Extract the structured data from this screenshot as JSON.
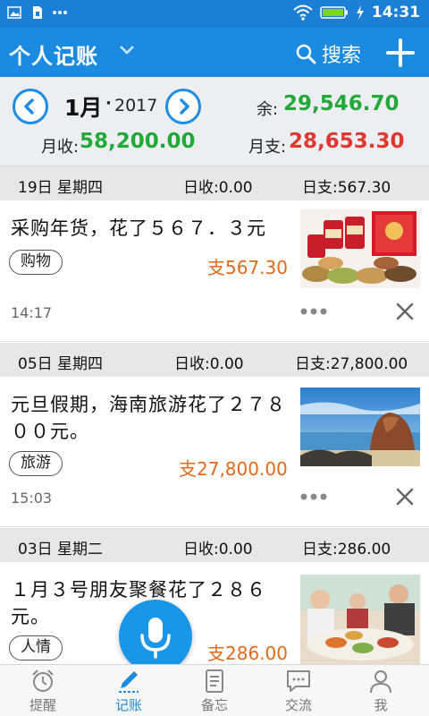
{
  "status_bar": {
    "time": "14:31"
  },
  "app_bar": {
    "title": "个人记账",
    "search_label": "搜索"
  },
  "summary": {
    "month": "1月",
    "dot": "·",
    "year": "2017",
    "balance_label": "余:",
    "balance_value": "29,546.70",
    "income_label": "月收:",
    "income_value": "58,200.00",
    "expense_label": "月支:",
    "expense_value": "28,653.30"
  },
  "days": [
    {
      "date": "19日  星期四",
      "income": "日收:0.00",
      "expense": "日支:567.30",
      "record": {
        "text": "采购年货，花了５６７．３元",
        "tag": "购物",
        "amount": "支567.30",
        "time": "14:17"
      }
    },
    {
      "date": "05日  星期四",
      "income": "日收:0.00",
      "expense": "日支:27,800.00",
      "record": {
        "text": "元旦假期，海南旅游花了２７８００元。",
        "tag": "旅游",
        "amount": "支27,800.00",
        "time": "15:03"
      }
    },
    {
      "date": "03日  星期二",
      "income": "日收:0.00",
      "expense": "日支:286.00",
      "record": {
        "text": "１月３号朋友聚餐花了２８６元。",
        "tag": "人情",
        "amount": "支286.00"
      }
    }
  ],
  "bottom_nav": [
    {
      "label": "提醒",
      "icon": "alarm-clock-icon"
    },
    {
      "label": "记账",
      "icon": "pencil-icon"
    },
    {
      "label": "备忘",
      "icon": "memo-icon"
    },
    {
      "label": "交流",
      "icon": "chat-icon"
    },
    {
      "label": "我",
      "icon": "person-icon"
    }
  ],
  "colors": {
    "primary": "#1a8be0",
    "income": "#23a83a",
    "expense": "#e0372f",
    "amount": "#e06a1c"
  }
}
